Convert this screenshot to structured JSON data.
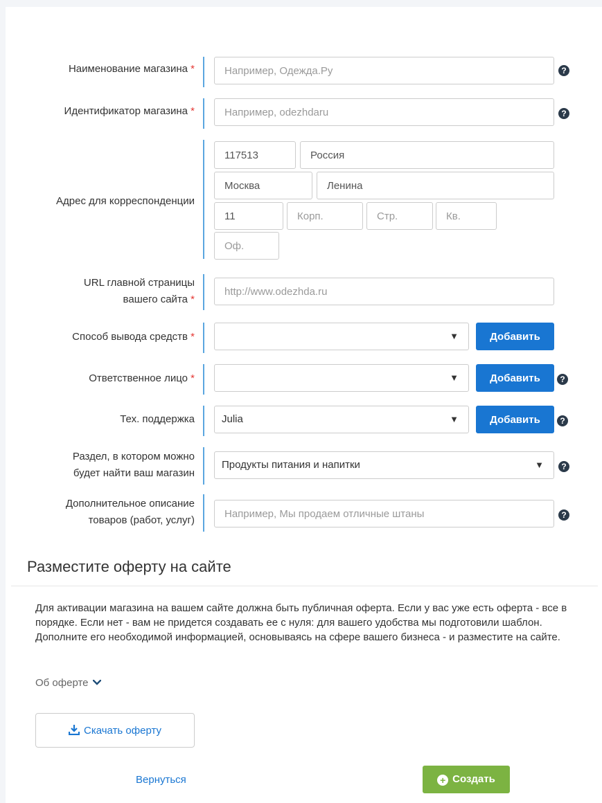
{
  "form": {
    "store_name": {
      "label": "Наименование магазина",
      "placeholder": "Например, Одежда.Ру",
      "required": "*"
    },
    "store_id": {
      "label": "Идентификатор магазина",
      "placeholder": "Например, odezhdaru",
      "required": "*"
    },
    "address": {
      "label": "Адрес для корреспонденции",
      "zip": "117513",
      "country": "Россия",
      "city": "Москва",
      "street": "Ленина",
      "house": "11",
      "korp_placeholder": "Корп.",
      "str_placeholder": "Стр.",
      "kv_placeholder": "Кв.",
      "of_placeholder": "Оф."
    },
    "site_url": {
      "label_line1": "URL главной страницы",
      "label_line2": "вашего сайта",
      "placeholder": "http://www.odezhda.ru",
      "required": "*"
    },
    "withdrawal": {
      "label": "Способ вывода средств",
      "value": "",
      "required": "*",
      "add_label": "Добавить"
    },
    "responsible": {
      "label": "Ответственное лицо",
      "value": "",
      "required": "*",
      "add_label": "Добавить"
    },
    "support": {
      "label": "Тех. поддержка",
      "value": "Julia",
      "add_label": "Добавить"
    },
    "section": {
      "label_line1": "Раздел, в котором можно",
      "label_line2": "будет найти ваш магазин",
      "value": "Продукты питания и напитки"
    },
    "description": {
      "label_line1": "Дополнительное описание",
      "label_line2": "товаров (работ, услуг)",
      "placeholder": "Например, Мы продаем отличные штаны"
    },
    "help_glyph": "?",
    "caret_glyph": "▼"
  },
  "offer": {
    "title": "Разместите оферту на сайте",
    "text": "Для активации магазина на вашем сайте должна быть публичная оферта. Если у вас уже есть оферта - все в порядке. Если нет - вам не придется создавать ее с нуля: для вашего удобства мы подготовили шаблон. Дополните его необходимой информацией, основываясь на сфере вашего бизнеса - и разместите на сайте.",
    "about_label": "Об оферте",
    "download_label": "Скачать оферту"
  },
  "actions": {
    "back_label": "Вернуться",
    "create_label": "Создать"
  },
  "colors": {
    "accent_blue": "#1976d2",
    "create_green": "#7cb342",
    "required_red": "#e53935",
    "label_line": "#5aa6e0"
  }
}
